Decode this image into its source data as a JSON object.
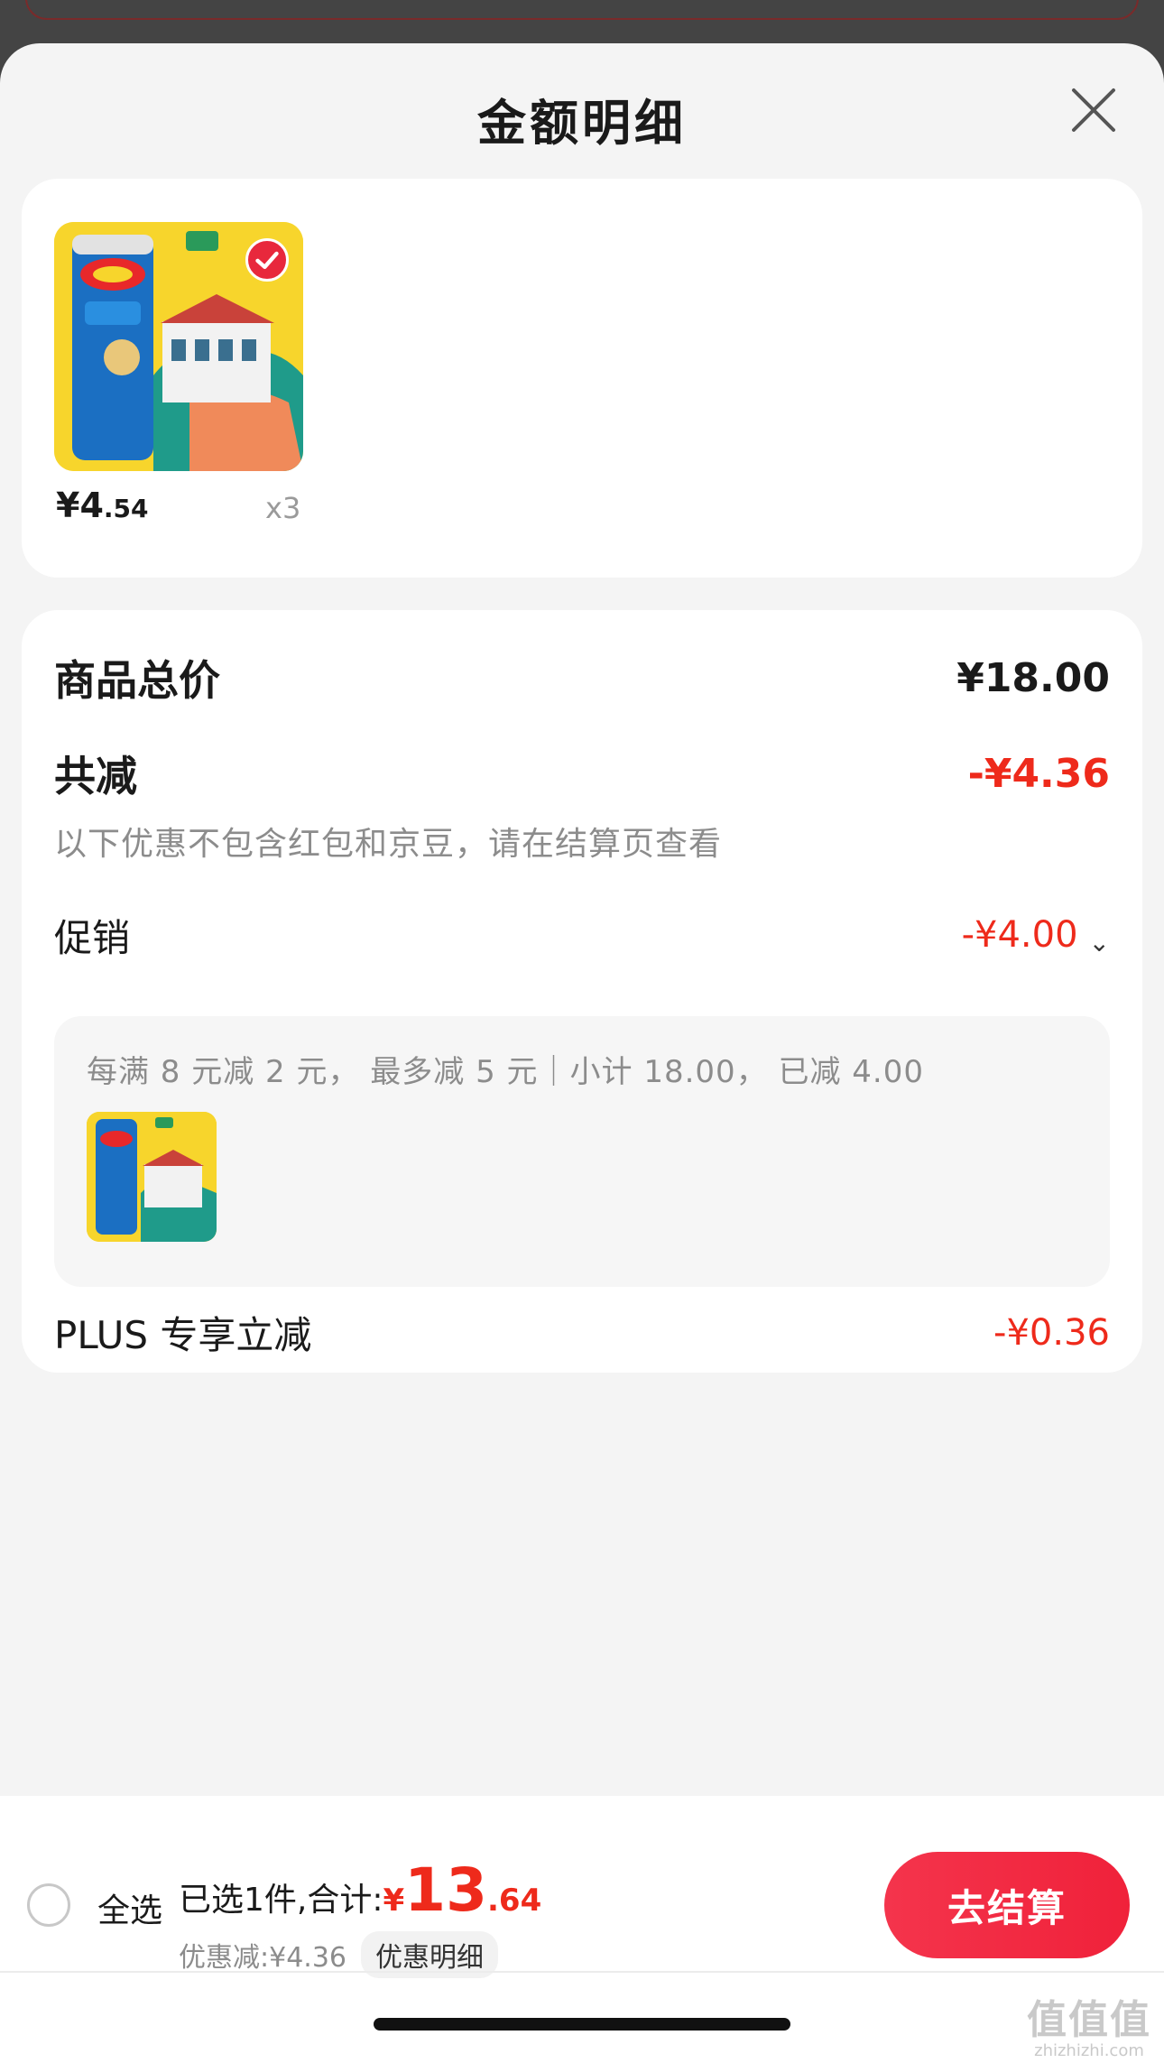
{
  "sheet": {
    "title": "金额明细"
  },
  "product": {
    "price_int": "¥4",
    "price_dec": ".54",
    "quantity": "x3",
    "image_icon": "lays-chips-can-image",
    "selected": true
  },
  "summary": {
    "subtotal_label": "商品总价",
    "subtotal_value": "¥18.00",
    "discount_label": "共减",
    "discount_value": "-¥4.36",
    "note": "以下优惠不包含红包和京豆，请在结算页查看",
    "promo_label": "促销",
    "promo_value": "-¥4.00",
    "promo_rule": "每满 8 元减 2 元，  最多减 5 元｜小计 18.00，  已减 4.00",
    "plus_label": "PLUS 专享立减",
    "plus_value": "-¥0.36"
  },
  "bottom": {
    "select_all": "全选",
    "selected_text": "已选1件,合计:",
    "total_yen": "¥",
    "total_int": "13",
    "total_dec": ".64",
    "discount_text": "优惠减:¥4.36",
    "detail_chip": "优惠明细",
    "checkout": "去结算"
  },
  "watermark": {
    "big": "值值值",
    "small": "zhizhizhi.com"
  },
  "colors": {
    "accent_red": "#ee2a1b",
    "button_red": "#f0213a",
    "sheet_bg": "#f4f4f4"
  }
}
